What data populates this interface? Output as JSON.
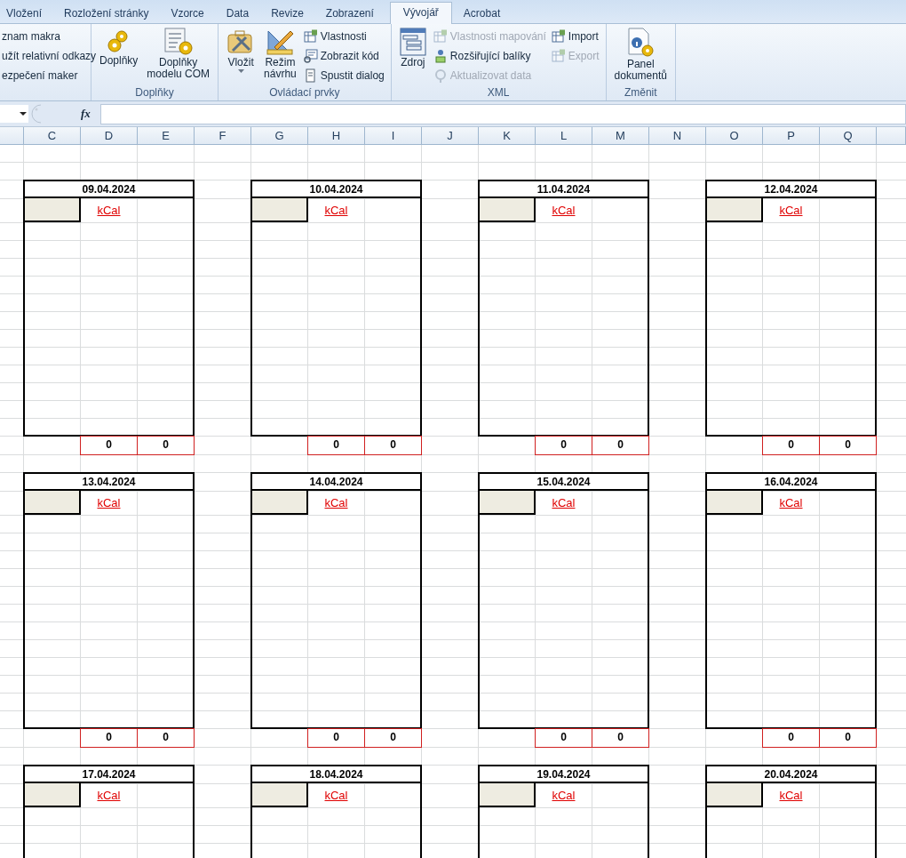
{
  "tabs": [
    {
      "label": "Vložení",
      "selected": false
    },
    {
      "label": "Rozložení stránky",
      "selected": false
    },
    {
      "label": "Vzorce",
      "selected": false
    },
    {
      "label": "Data",
      "selected": false
    },
    {
      "label": "Revize",
      "selected": false
    },
    {
      "label": "Zobrazení",
      "selected": false
    },
    {
      "label": "Vývojář",
      "selected": true
    },
    {
      "label": "Acrobat",
      "selected": false
    }
  ],
  "ribbon": {
    "groups": [
      {
        "small": [
          {
            "label": "znam makra",
            "disabled": false
          },
          {
            "label": "užít relativní odkazy",
            "disabled": false
          },
          {
            "label": "ezpečení maker",
            "disabled": false
          }
        ]
      },
      {
        "label": "Doplňky",
        "large": [
          {
            "label": "Doplňky",
            "dropdown": false
          },
          {
            "label": "Doplňky\nmodelu COM",
            "dropdown": false
          }
        ]
      },
      {
        "label": "Ovládací prvky",
        "large": [
          {
            "label": "Vložit",
            "dropdown": true
          },
          {
            "label": "Režim\nnávrhu",
            "dropdown": false
          }
        ],
        "small": [
          {
            "label": "Vlastnosti",
            "disabled": false
          },
          {
            "label": "Zobrazit kód",
            "disabled": false
          },
          {
            "label": "Spustit dialog",
            "disabled": false
          }
        ]
      },
      {
        "label": "XML",
        "large": [
          {
            "label": "Zdroj",
            "dropdown": false
          }
        ],
        "small": [
          {
            "label": "Vlastnosti mapování",
            "disabled": true
          },
          {
            "label": "Rozšiřující balíky",
            "disabled": false
          },
          {
            "label": "Aktualizovat data",
            "disabled": true
          },
          {
            "label": "Import",
            "disabled": false
          },
          {
            "label": "Export",
            "disabled": true
          }
        ]
      },
      {
        "label": "Změnit",
        "large": [
          {
            "label": "Panel\ndokumentů",
            "dropdown": false
          }
        ]
      }
    ]
  },
  "formula_bar": {
    "fx": "fx"
  },
  "column_headers": [
    "C",
    "D",
    "E",
    "F",
    "G",
    "H",
    "I",
    "J",
    "K",
    "L",
    "M",
    "N",
    "O",
    "P",
    "Q"
  ],
  "card_rows": [
    {
      "cards": [
        {
          "date": "09.04.2024",
          "unit": "kCal",
          "totals": [
            "0",
            "0"
          ]
        },
        {
          "date": "10.04.2024",
          "unit": "kCal",
          "totals": [
            "0",
            "0"
          ]
        },
        {
          "date": "11.04.2024",
          "unit": "kCal",
          "totals": [
            "0",
            "0"
          ]
        },
        {
          "date": "12.04.2024",
          "unit": "kCal",
          "totals": [
            "0",
            "0"
          ]
        }
      ]
    },
    {
      "cards": [
        {
          "date": "13.04.2024",
          "unit": "kCal",
          "totals": [
            "0",
            "0"
          ]
        },
        {
          "date": "14.04.2024",
          "unit": "kCal",
          "totals": [
            "0",
            "0"
          ]
        },
        {
          "date": "15.04.2024",
          "unit": "kCal",
          "totals": [
            "0",
            "0"
          ]
        },
        {
          "date": "16.04.2024",
          "unit": "kCal",
          "totals": [
            "0",
            "0"
          ]
        }
      ]
    },
    {
      "cards": [
        {
          "date": "17.04.2024",
          "unit": "kCal"
        },
        {
          "date": "18.04.2024",
          "unit": "kCal"
        },
        {
          "date": "19.04.2024",
          "unit": "kCal"
        },
        {
          "date": "20.04.2024",
          "unit": "kCal"
        }
      ]
    }
  ]
}
